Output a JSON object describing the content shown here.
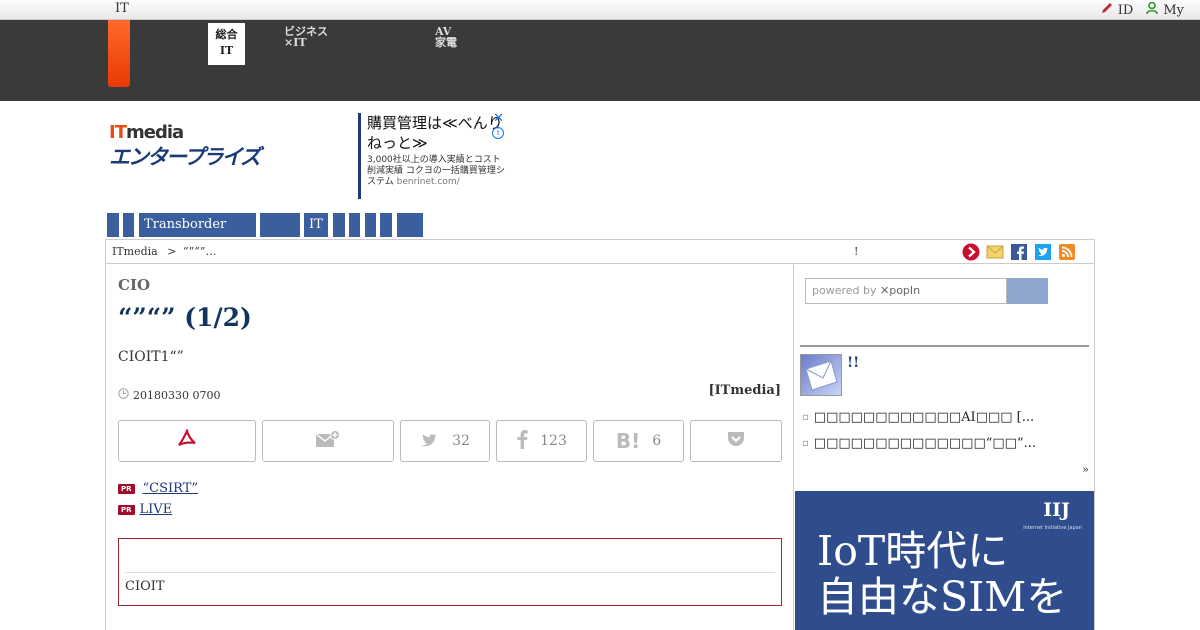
{
  "topbar": {
    "it": "IT",
    "id_link": "ID",
    "my_link": "My"
  },
  "globalnav": {
    "active": {
      "line1": "総合",
      "line2": "IT"
    },
    "item2": {
      "line1": "ビジネス",
      "line2": "×IT"
    },
    "item3": {
      "line1": "AV",
      "line2": "家電"
    }
  },
  "header": {
    "logo_it": "IT",
    "logo_media": "media",
    "logo_enterprise": "エンタープライズ",
    "ad": {
      "headline": "購買管理は≪べんりねっと≫",
      "body": "3,000社以上の導入実績とコスト削減実績 コクヨの一括購買管理システム",
      "domain": "benrinet.com/",
      "close": "✕",
      "info": "i"
    }
  },
  "catnav": [
    {
      "label": ""
    },
    {
      "label": ""
    },
    {
      "label": "Transborder"
    },
    {
      "label": ""
    },
    {
      "label": "IT"
    },
    {
      "label": ""
    },
    {
      "label": ""
    },
    {
      "label": ""
    },
    {
      "label": ""
    },
    {
      "label": ""
    }
  ],
  "crumb": {
    "home": "ITmedia",
    "sep": ">",
    "current": "“”“”…",
    "mark": "!"
  },
  "article": {
    "kicker": "CIO",
    "headline": "“”“” (1/2)",
    "lede": "CIOIT1“”",
    "date": "20180330 0700",
    "source": "[ITmedia]",
    "share": {
      "twitter_count": "32",
      "facebook_count": "123",
      "hatena_count": "6"
    },
    "pr": [
      {
        "badge": "PR",
        "text": "“CSIRT”"
      },
      {
        "badge": "PR",
        "text": "LIVE"
      }
    ],
    "box_text": "CIOIT"
  },
  "sidebar": {
    "search_placeholder": "powered by",
    "search_brand": "popIn",
    "title": "!!",
    "items": [
      "□□□□□□□□□□□□AI□□□ [...",
      "□□□□□□□□□□□□□□“□□”..."
    ],
    "more": "»",
    "banner": {
      "brand": "IIJ",
      "brand_sub": "Internet Initiative Japan",
      "line1": "IoT時代に",
      "line2": "自由なSIMを"
    }
  },
  "colors": {
    "accent": "#3a5f9e",
    "nav_dark": "#3a3a3a",
    "orange": "#e94e0f",
    "pr": "#a30d2c"
  }
}
